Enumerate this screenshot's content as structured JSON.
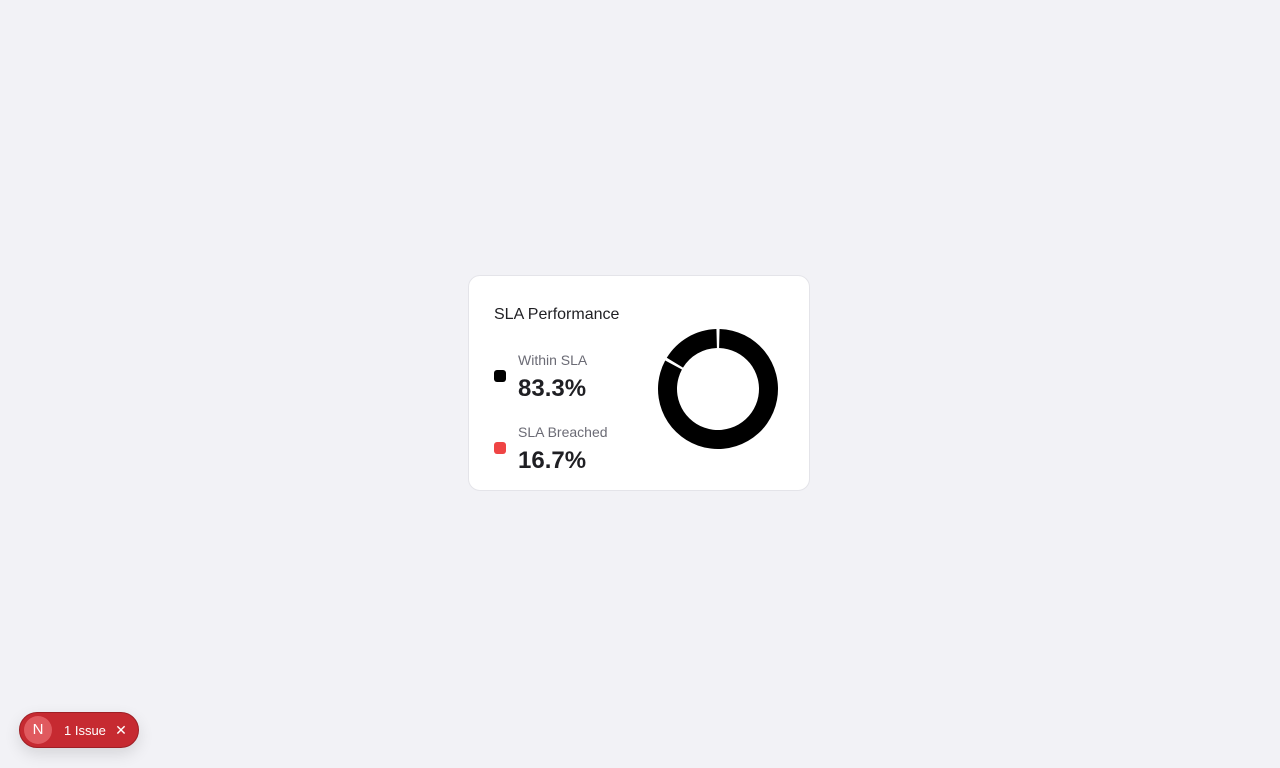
{
  "card": {
    "title": "SLA Performance",
    "legend": [
      {
        "label": "Within SLA",
        "value": "83.3%",
        "color": "#000000"
      },
      {
        "label": "SLA Breached",
        "value": "16.7%",
        "color": "#ef4444"
      }
    ]
  },
  "chart_data": {
    "type": "pie",
    "categories": [
      "Within SLA",
      "SLA Breached"
    ],
    "values": [
      83.3,
      16.7
    ],
    "colors": [
      "#000000",
      "#000000"
    ],
    "donut": true,
    "title": "SLA Performance"
  },
  "issues_badge": {
    "logo_letter": "N",
    "label": "1 Issue",
    "close_icon": "close-icon"
  }
}
